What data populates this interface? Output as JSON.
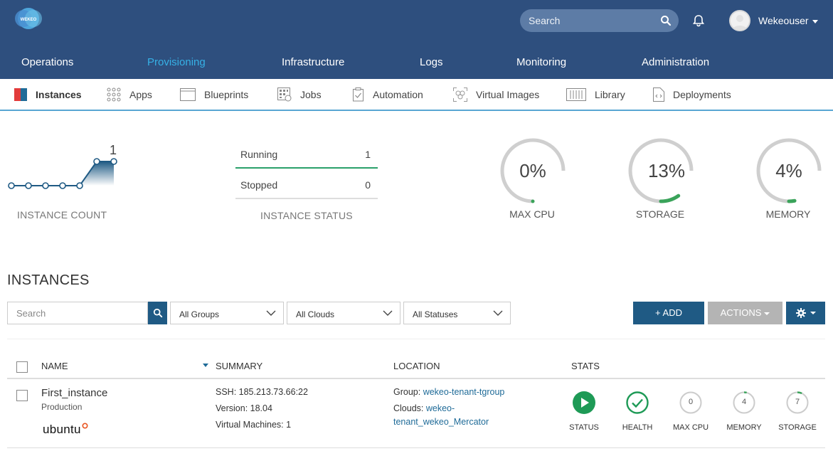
{
  "header": {
    "search_placeholder": "Search",
    "username": "Wekeouser",
    "logo_text": "WEKEO"
  },
  "main_nav": [
    {
      "label": "Operations",
      "active": false
    },
    {
      "label": "Provisioning",
      "active": true
    },
    {
      "label": "Infrastructure",
      "active": false
    },
    {
      "label": "Logs",
      "active": false
    },
    {
      "label": "Monitoring",
      "active": false
    },
    {
      "label": "Administration",
      "active": false
    }
  ],
  "sub_nav": [
    {
      "label": "Instances",
      "icon": "instances-icon",
      "active": true
    },
    {
      "label": "Apps",
      "icon": "apps-grid-icon",
      "active": false
    },
    {
      "label": "Blueprints",
      "icon": "blueprints-icon",
      "active": false
    },
    {
      "label": "Jobs",
      "icon": "jobs-icon",
      "active": false
    },
    {
      "label": "Automation",
      "icon": "automation-icon",
      "active": false
    },
    {
      "label": "Virtual Images",
      "icon": "virtual-images-icon",
      "active": false
    },
    {
      "label": "Library",
      "icon": "library-icon",
      "active": false
    },
    {
      "label": "Deployments",
      "icon": "deployments-icon",
      "active": false
    }
  ],
  "stats": {
    "instance_count": {
      "label": "INSTANCE COUNT",
      "current": "1",
      "history": [
        0,
        0,
        0,
        0,
        0,
        1,
        1
      ]
    },
    "instance_status": {
      "label": "INSTANCE STATUS",
      "running_label": "Running",
      "running": "1",
      "stopped_label": "Stopped",
      "stopped": "0"
    },
    "max_cpu": {
      "label": "MAX CPU",
      "value": "0%",
      "fraction": 0.0
    },
    "storage": {
      "label": "STORAGE",
      "value": "13%",
      "fraction": 0.13
    },
    "memory": {
      "label": "MEMORY",
      "value": "4%",
      "fraction": 0.04
    }
  },
  "instances": {
    "title": "INSTANCES",
    "search_placeholder": "Search",
    "filters": {
      "groups": "All Groups",
      "clouds": "All Clouds",
      "statuses": "All Statuses"
    },
    "add_label": "+ ADD",
    "actions_label": "ACTIONS",
    "columns": {
      "name": "NAME",
      "summary": "SUMMARY",
      "location": "LOCATION",
      "stats": "STATS"
    },
    "rows": [
      {
        "name": "First_instance",
        "environment": "Production",
        "os_logo": "ubuntu",
        "ssh": "SSH: 185.213.73.66:22",
        "version": "Version: 18.04",
        "virtual_machines": "Virtual Machines: 1",
        "group_label": "Group:",
        "group": "wekeo-tenant-tgroup",
        "clouds_label": "Clouds:",
        "clouds_line1": "wekeo-",
        "clouds_line2": "tenant_wekeo_Mercator",
        "stats": {
          "status_label": "STATUS",
          "health_label": "HEALTH",
          "max_cpu_label": "MAX CPU",
          "max_cpu": "0",
          "memory_label": "MEMORY",
          "memory": "4",
          "storage_label": "STORAGE",
          "storage": "7"
        }
      }
    ]
  },
  "colors": {
    "header_bg": "#2e4f7e",
    "active_nav": "#36b1e6",
    "primary_button": "#1f5a84",
    "success": "#1e9a56",
    "gauge_track": "#cccccc",
    "gauge_fill": "#3aa35a"
  }
}
